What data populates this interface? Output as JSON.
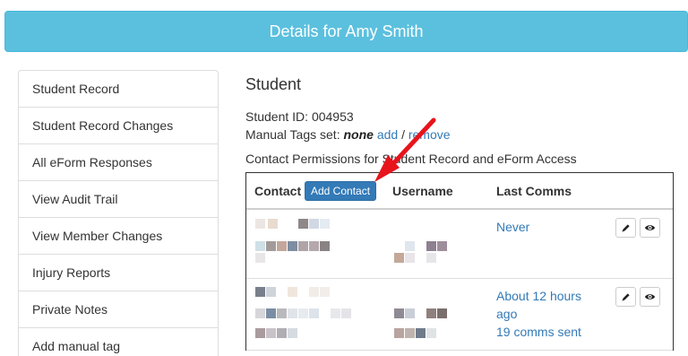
{
  "header": {
    "title": "Details for Amy Smith"
  },
  "sidebar": {
    "items": [
      {
        "label": "Student Record"
      },
      {
        "label": "Student Record Changes"
      },
      {
        "label": "All eForm Responses"
      },
      {
        "label": "View Audit Trail"
      },
      {
        "label": "View Member Changes"
      },
      {
        "label": "Injury Reports"
      },
      {
        "label": "Private Notes"
      },
      {
        "label": "Add manual tag"
      }
    ]
  },
  "student": {
    "section_title": "Student",
    "id_label": "Student ID:",
    "id_value": "004953",
    "tags_label": "Manual Tags set:",
    "tags_value": "none",
    "add_link": "add",
    "separator": "/",
    "remove_link": "remove",
    "permissions_text": "Contact Permissions for Student Record and eForm Access"
  },
  "contacts_table": {
    "headers": {
      "contact": "Contact",
      "username": "Username",
      "last_comms": "Last Comms"
    },
    "add_contact_label": "Add Contact",
    "rows": [
      {
        "last_comms": "Never",
        "comms_sent": ""
      },
      {
        "last_comms": "About 12 hours ago",
        "comms_sent": "19 comms sent"
      }
    ]
  },
  "colors": {
    "header_bg": "#5bc0de",
    "link": "#337ab7",
    "button_primary": "#337ab7",
    "annotation_arrow": "#e8141c"
  },
  "icons": [
    "pencil-icon",
    "eye-icon"
  ]
}
